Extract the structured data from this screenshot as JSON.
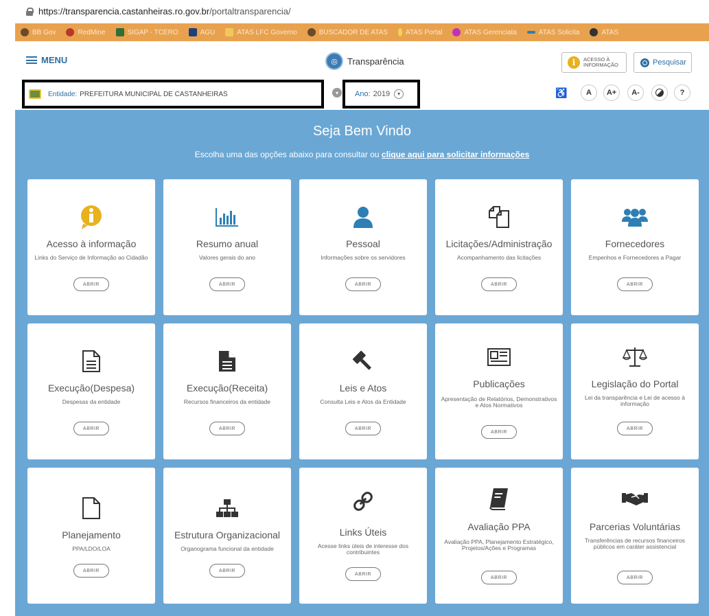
{
  "browser": {
    "url_host": "https://transparencia.castanheiras.ro.gov.br",
    "url_path": "/portaltransparencia/",
    "bookmarks": [
      "BB Gov",
      "RedMine",
      "SIGAP - TCERO",
      "AGU",
      "ATAS LFC Governo",
      "BUSCADOR DE ATAS",
      "ATAS Portal",
      "ATAS Gerenciata",
      "ATAS Solicita",
      "ATAS"
    ]
  },
  "header": {
    "menu_label": "MENU",
    "brand_title": "Transparência",
    "acesso_line1": "ACESSO À",
    "acesso_line2": "INFORMAÇÃO",
    "search_label": "Pesquisar"
  },
  "filters": {
    "entidade_label": "Entidade:",
    "entidade_value": "PREFEITURA MUNICIPAL DE CASTANHEIRAS",
    "ano_label": "Ano:",
    "ano_value": "2019",
    "accessibility": [
      "A",
      "A+",
      "A-",
      "?"
    ]
  },
  "main": {
    "welcome": "Seja Bem Vindo",
    "subtitle": "Escolha uma das opções abaixo para consultar ou",
    "subtitle_link": "clique aqui para solicitar informações"
  },
  "open_label": "ABRIR",
  "cards": [
    {
      "title": "Acesso à informação",
      "desc": "Links do Serviço de Informação ao Cidadão",
      "icon": "info-icon"
    },
    {
      "title": "Resumo anual",
      "desc": "Valores gerais do ano",
      "icon": "bar-chart-icon"
    },
    {
      "title": "Pessoal",
      "desc": "Informações sobre os servidores",
      "icon": "user-icon"
    },
    {
      "title": "Licitações/Administração",
      "desc": "Acompanhamento das licitações",
      "icon": "documents-icon"
    },
    {
      "title": "Fornecedores",
      "desc": "Empenhos e Fornecedores a Pagar",
      "icon": "users-icon"
    },
    {
      "title": "Execução(Despesa)",
      "desc": "Despesas da entidade",
      "icon": "document-outline-icon"
    },
    {
      "title": "Execução(Receita)",
      "desc": "Recursos financeiros da entidade",
      "icon": "document-filled-icon"
    },
    {
      "title": "Leis e Atos",
      "desc": "Consulta Leis e Atos da Entidade",
      "icon": "gavel-icon"
    },
    {
      "title": "Publicações",
      "desc": "Apresentação de Relatórios, Demonstrativos e Atos Normativos",
      "icon": "newspaper-icon"
    },
    {
      "title": "Legislação do Portal",
      "desc": "Lei da transparência e Lei de acesso à informação",
      "icon": "scales-icon"
    },
    {
      "title": "Planejamento",
      "desc": "PPA/LDO/LOA",
      "icon": "file-outline-icon"
    },
    {
      "title": "Estrutura Organizacional",
      "desc": "Organograma funcional da entidade",
      "icon": "sitemap-icon"
    },
    {
      "title": "Links Úteis",
      "desc": "Acesse links úteis de interesse dos contribuintes",
      "icon": "link-icon"
    },
    {
      "title": "Avaliação PPA",
      "desc": "Avaliação PPA, Planejamento Estratégico, Projetos/Ações e Programas",
      "icon": "book-icon"
    },
    {
      "title": "Parcerias Voluntárias",
      "desc": "Transferências de recursos financeiros públicos em caráter assistencial",
      "icon": "handshake-icon"
    }
  ]
}
